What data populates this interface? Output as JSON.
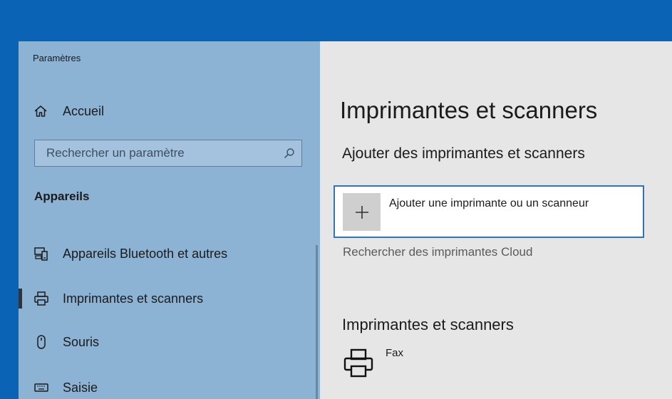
{
  "window": {
    "title": "Paramètres"
  },
  "sidebar": {
    "home_label": "Accueil",
    "search_placeholder": "Rechercher un paramètre",
    "section_label": "Appareils",
    "items": [
      {
        "label": "Appareils Bluetooth et autres",
        "icon": "bluetooth-devices-icon",
        "selected": false
      },
      {
        "label": "Imprimantes et scanners",
        "icon": "printer-icon",
        "selected": true
      },
      {
        "label": "Souris",
        "icon": "mouse-icon",
        "selected": false
      },
      {
        "label": "Saisie",
        "icon": "keyboard-icon",
        "selected": false
      }
    ]
  },
  "main": {
    "title": "Imprimantes et scanners",
    "add_section_title": "Ajouter des imprimantes et scanners",
    "add_button_label": "Ajouter une imprimante ou un scanneur",
    "cloud_link": "Rechercher des imprimantes Cloud",
    "printers_section_title": "Imprimantes et scanners",
    "printers": [
      {
        "name": "Fax",
        "icon": "printer-icon"
      }
    ]
  },
  "colors": {
    "desktop_blue": "#0a63b4",
    "sidebar_bg": "#8db3d4",
    "content_bg": "#e6e6e6",
    "accent_border": "#2f73bb"
  }
}
